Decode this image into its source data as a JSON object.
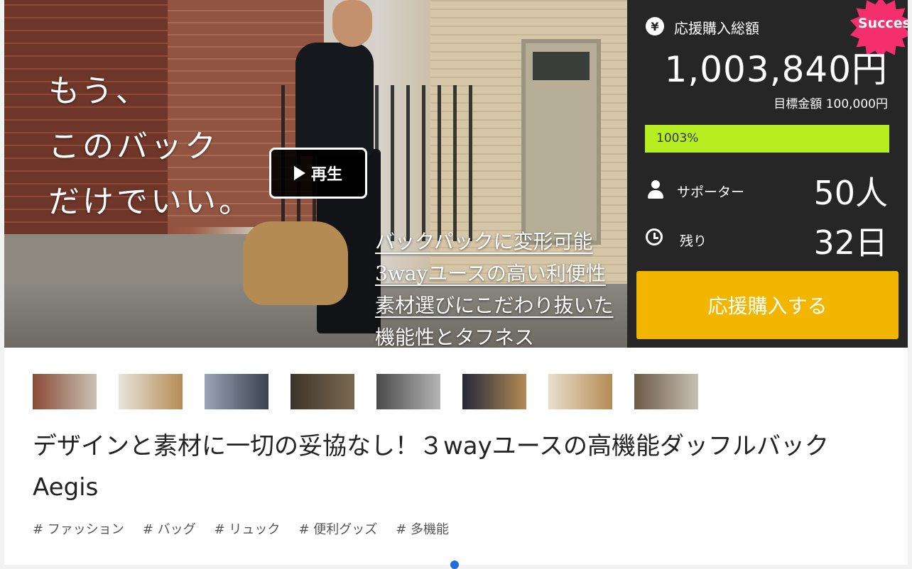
{
  "hero": {
    "headline_lines": [
      "もう、",
      "このバック",
      "だけでいい。"
    ],
    "features": [
      "バックパックに変形可能",
      "3wayユースの高い利便性",
      "素材選びにこだわり抜いた",
      "機能性とタフネス"
    ],
    "play_label": "再生"
  },
  "panel": {
    "badge": "Success!",
    "badge_color": "#f52e6e",
    "yen_symbol": "¥",
    "total_label": "応援購入総額",
    "total_amount": "1,003,840円",
    "goal_text": "目標金額 100,000円",
    "progress_percent_text": "1003%",
    "progress_fraction": 1.0,
    "progress_color": "#b6ee1f",
    "supporters_label": "サポーター",
    "supporters_value": "50人",
    "remaining_label": "残り",
    "remaining_value": "32日",
    "cta_label": "応援購入する",
    "cta_color": "#f2b500"
  },
  "thumbnails": [
    {
      "label": "thumbnail-1",
      "colors": [
        "#8b4a38",
        "#c9c2b4"
      ]
    },
    {
      "label": "thumbnail-2",
      "colors": [
        "#e8e4dc",
        "#b58b54"
      ]
    },
    {
      "label": "thumbnail-3",
      "colors": [
        "#9aa4b4",
        "#3a4150"
      ]
    },
    {
      "label": "thumbnail-4",
      "colors": [
        "#3d3328",
        "#7a6a52"
      ]
    },
    {
      "label": "thumbnail-5",
      "colors": [
        "#4a4a4a",
        "#b5b5b5"
      ]
    },
    {
      "label": "thumbnail-6",
      "colors": [
        "#24283a",
        "#b58b54"
      ]
    },
    {
      "label": "thumbnail-7",
      "colors": [
        "#e9dfcd",
        "#b58b54"
      ]
    },
    {
      "label": "thumbnail-8",
      "colors": [
        "#6b5a48",
        "#c8c0b2"
      ]
    }
  ],
  "title": "デザインと素材に一切の妥協なし！３wayユースの高機能ダッフルバック Aegis",
  "tags": [
    "# ファッション",
    "# バッグ",
    "# リュック",
    "# 便利グッズ",
    "# 多機能"
  ]
}
